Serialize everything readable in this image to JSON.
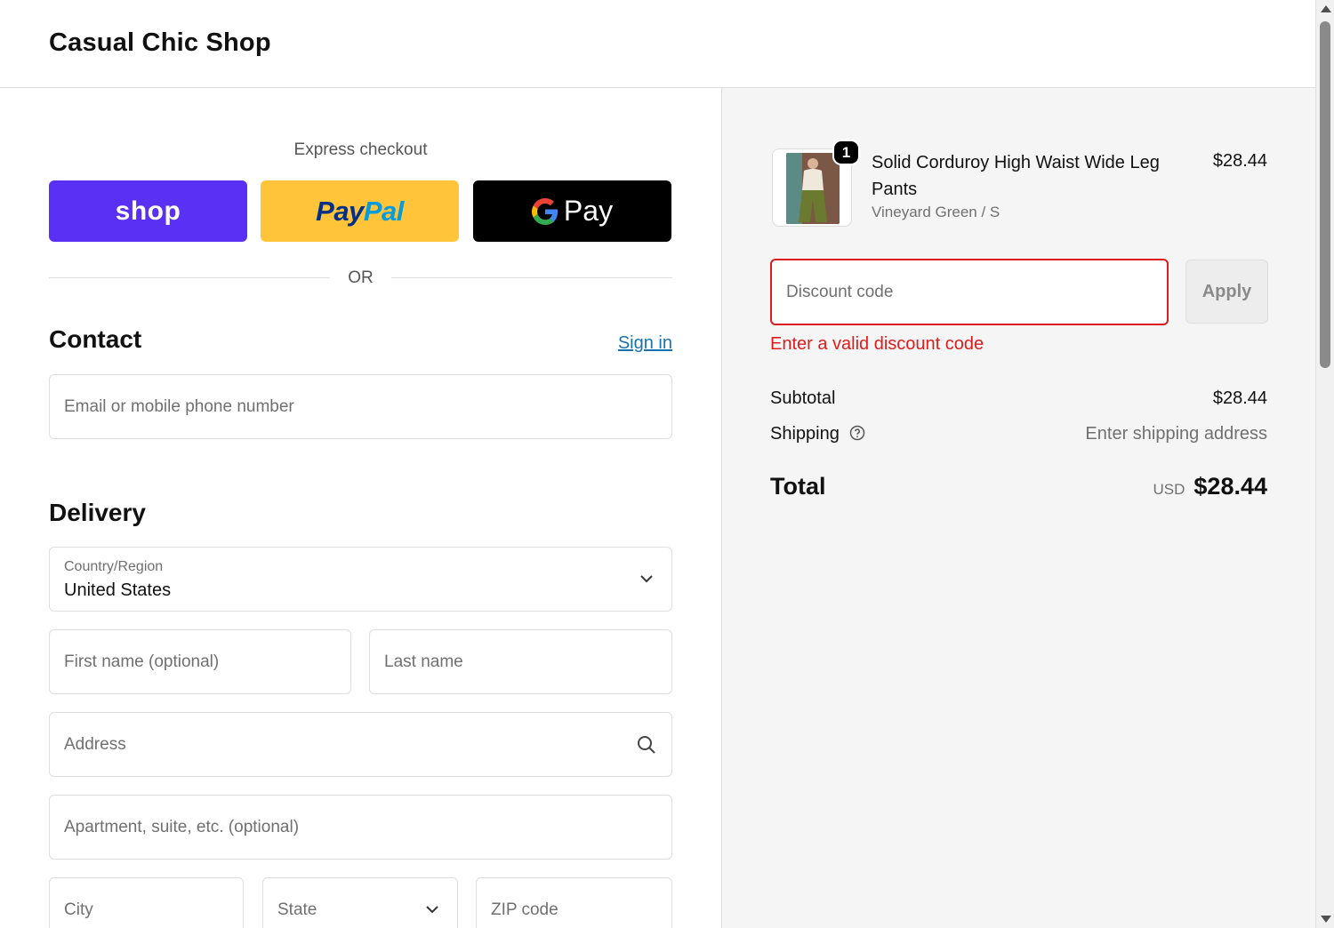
{
  "header": {
    "shop_name": "Casual Chic Shop"
  },
  "express": {
    "label": "Express checkout",
    "shop_label": "shop",
    "paypal_part1": "Pay",
    "paypal_part2": "Pal",
    "gpay_label": "Pay",
    "or_label": "OR"
  },
  "contact": {
    "title": "Contact",
    "sign_in": "Sign in",
    "email_placeholder": "Email or mobile phone number"
  },
  "delivery": {
    "title": "Delivery",
    "country_label": "Country/Region",
    "country_value": "United States",
    "first_name_placeholder": "First name (optional)",
    "last_name_placeholder": "Last name",
    "address_placeholder": "Address",
    "apartment_placeholder": "Apartment, suite, etc. (optional)",
    "city_placeholder": "City",
    "state_placeholder": "State",
    "zip_placeholder": "ZIP code"
  },
  "order": {
    "quantity": "1",
    "product_title": "Solid Corduroy High Waist Wide Leg Pants",
    "variant": "Vineyard Green / S",
    "price": "$28.44",
    "discount_placeholder": "Discount code",
    "apply_label": "Apply",
    "discount_error": "Enter a valid discount code",
    "subtotal_label": "Subtotal",
    "subtotal_value": "$28.44",
    "shipping_label": "Shipping",
    "shipping_value": "Enter shipping address",
    "total_label": "Total",
    "currency": "USD",
    "total_value": "$28.44"
  },
  "colors": {
    "shop_pay": "#5a31f4",
    "paypal": "#ffc439",
    "gpay": "#000000",
    "link": "#1773b0",
    "error": "#dd1d1d"
  },
  "icons": {
    "country_trailing": "chevron-down-icon",
    "address_trailing": "search-icon",
    "shipping_help": "help-circle-icon"
  }
}
